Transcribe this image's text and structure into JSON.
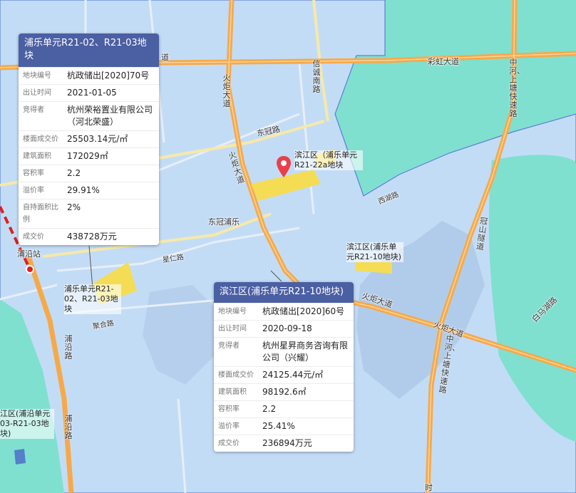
{
  "map": {
    "colors": {
      "district": "#c3dcf6",
      "outside": "#7fe0d0",
      "expressway": "#f6a94a",
      "road": "#f6e9a8",
      "plot": "#f4dc55",
      "metro": "#e01e1e"
    }
  },
  "roads": {
    "caihong": "彩虹大道",
    "xincheng": "信诚南路",
    "huoju_north": "火炬大道",
    "dongguan": "东冠路",
    "huoju_center": "火炬大道",
    "dongguan_pule": "东冠浦乐",
    "xingren": "星仁路",
    "juhe": "聚合路",
    "huoju_south": "火炬大道",
    "zhonghe": "中河、上塘快速路",
    "zhonghe_south": "中河、上塘快速路",
    "guanshan": "冠山隧道",
    "baima": "白马湖路",
    "puyan": "浦沿路",
    "puyan_station": "浦沿站",
    "xiyuan": "西湖路",
    "dao_fragment": "道",
    "shi_fragment": "时"
  },
  "plots": {
    "r2122a": "滨江区（浦乐单元R21-22a地块",
    "r2110": "滨江区(浦乐单元R21-10地块)",
    "r2102": "浦乐单元R21-02、R21-03地块",
    "puyan_left": "江区(浦沿单元 03-R21-03地块)"
  },
  "cards": [
    {
      "title": "浦乐单元R21-02、R21-03地块",
      "rows": [
        {
          "k": "地块编号",
          "v": "杭政储出[2020]70号"
        },
        {
          "k": "出让时间",
          "v": "2021-01-05"
        },
        {
          "k": "竞得者",
          "v": "杭州荣裕置业有限公司（河北荣盛）"
        },
        {
          "k": "楼面成交价",
          "v": "25503.14元/㎡"
        },
        {
          "k": "建筑面积",
          "v": "172029㎡"
        },
        {
          "k": "容积率",
          "v": "2.2"
        },
        {
          "k": "溢价率",
          "v": "29.91%"
        },
        {
          "k": "自持面积比例",
          "v": "2%"
        },
        {
          "k": "成交价",
          "v": "438728万元"
        }
      ]
    },
    {
      "title": "滨江区(浦乐单元R21-10地块)",
      "rows": [
        {
          "k": "地块编号",
          "v": "杭政储出[2020]60号"
        },
        {
          "k": "出让时间",
          "v": "2020-09-18"
        },
        {
          "k": "竞得者",
          "v": "杭州星昇商务咨询有限公司（兴耀）"
        },
        {
          "k": "楼面成交价",
          "v": "24125.44元/㎡"
        },
        {
          "k": "建筑面积",
          "v": "98192.6㎡"
        },
        {
          "k": "容积率",
          "v": "2.2"
        },
        {
          "k": "溢价率",
          "v": "25.41%"
        },
        {
          "k": "成交价",
          "v": "236894万元"
        }
      ]
    }
  ]
}
